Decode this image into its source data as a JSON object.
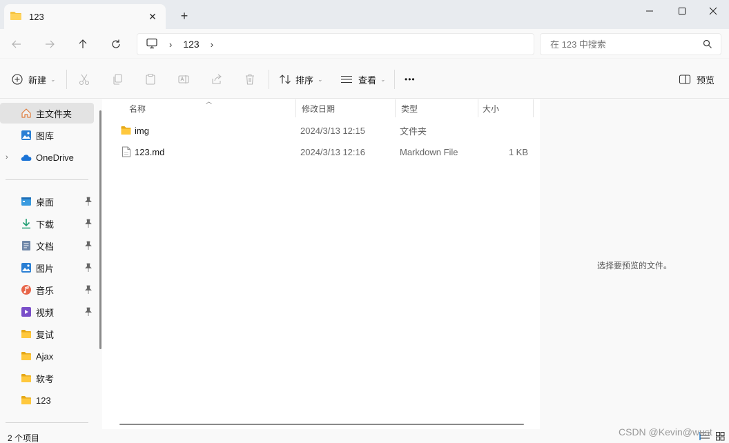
{
  "window": {
    "tab_title": "123",
    "new_tab_symbol": "+",
    "close_tab_symbol": "✕"
  },
  "address": {
    "breadcrumb": [
      "123"
    ],
    "search_placeholder": "在 123 中搜索"
  },
  "commands": {
    "new_label": "新建",
    "sort_label": "排序",
    "view_label": "查看",
    "more_label": "•••",
    "preview_label": "预览"
  },
  "sidebar": {
    "top_items": [
      {
        "label": "主文件夹",
        "icon": "home-icon",
        "selected": true
      },
      {
        "label": "图库",
        "icon": "gallery-icon"
      },
      {
        "label": "OneDrive",
        "icon": "onedrive-cloud-icon"
      }
    ],
    "quick_access": [
      {
        "label": "桌面",
        "icon": "desktop-icon",
        "pinned": true
      },
      {
        "label": "下载",
        "icon": "download-icon",
        "pinned": true
      },
      {
        "label": "文档",
        "icon": "documents-icon",
        "pinned": true
      },
      {
        "label": "图片",
        "icon": "pictures-icon",
        "pinned": true
      },
      {
        "label": "音乐",
        "icon": "music-icon",
        "pinned": true
      },
      {
        "label": "视频",
        "icon": "videos-icon",
        "pinned": true
      },
      {
        "label": "复试",
        "icon": "folder-icon",
        "pinned": false
      },
      {
        "label": "Ajax",
        "icon": "folder-icon",
        "pinned": false
      },
      {
        "label": "软考",
        "icon": "folder-icon",
        "pinned": false
      },
      {
        "label": "123",
        "icon": "folder-icon",
        "pinned": false
      }
    ]
  },
  "file_list": {
    "columns": [
      "名称",
      "修改日期",
      "类型",
      "大小"
    ],
    "rows": [
      {
        "name": "img",
        "modified": "2024/3/13 12:15",
        "type": "文件夹",
        "size": "",
        "icon": "folder-icon"
      },
      {
        "name": "123.md",
        "modified": "2024/3/13 12:16",
        "type": "Markdown File",
        "size": "1 KB",
        "icon": "file-icon"
      }
    ]
  },
  "preview": {
    "empty_text": "选择要预览的文件。"
  },
  "status": {
    "item_count": "2 个项目"
  },
  "watermark": "CSDN @Kevin@wust",
  "colors": {
    "folder": "#f5c342",
    "folder_dark": "#e6a817",
    "accent": "#0f6cbd",
    "chrome": "#f9f9f9",
    "titlebar": "#e8ebef"
  }
}
